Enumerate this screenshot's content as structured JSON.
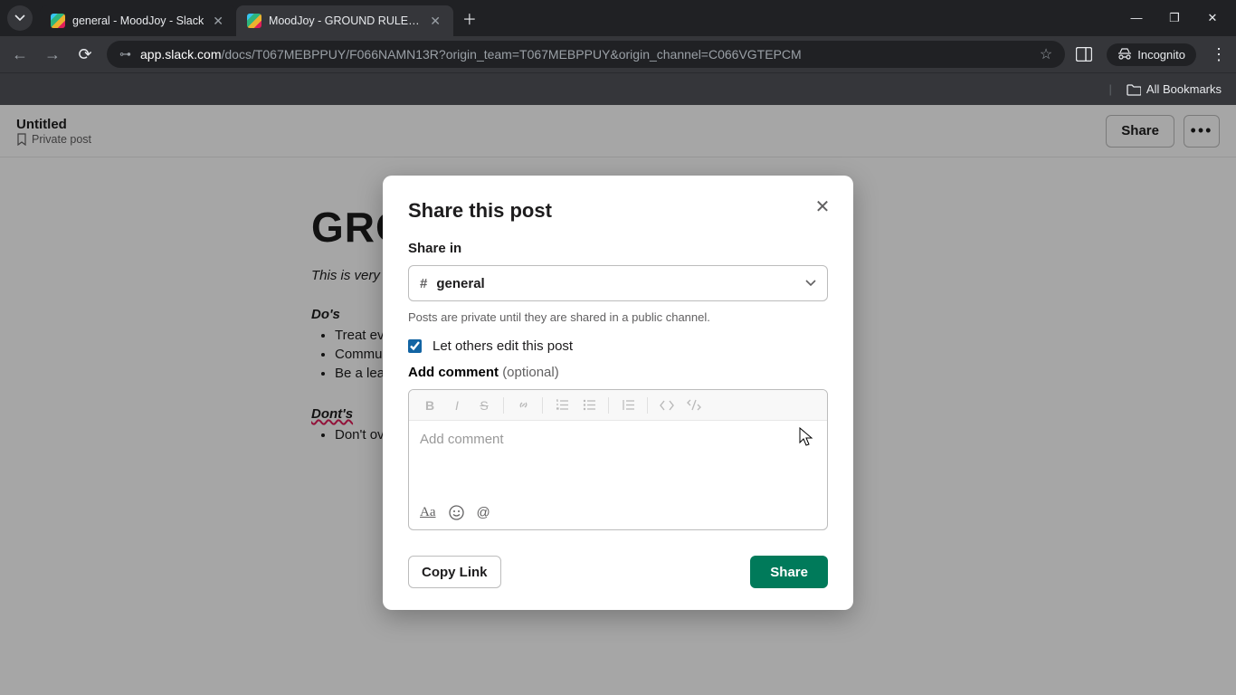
{
  "browser": {
    "tabs": [
      {
        "title": "general - MoodJoy - Slack",
        "active": false
      },
      {
        "title": "MoodJoy - GROUND RULES - S",
        "active": true
      }
    ],
    "url_host": "app.slack.com",
    "url_path": "/docs/T067MEBPPUY/F066NAMN13R?origin_team=T067MEBPPUY&origin_channel=C066VGTEPCM",
    "incognito_label": "Incognito",
    "all_bookmarks": "All Bookmarks"
  },
  "page": {
    "doc_title": "Untitled",
    "doc_privacy": "Private post",
    "share_button": "Share",
    "body": {
      "heading": "GRO",
      "intro": "This is very ir",
      "dos_label": "Do's",
      "dos_items": [
        "Treat ev",
        "Commur",
        "Be a lea"
      ],
      "donts_label": "Dont's",
      "donts_items": [
        "Don't ov"
      ]
    }
  },
  "modal": {
    "title": "Share this post",
    "share_in_label": "Share in",
    "channel_name": "general",
    "hint": "Posts are private until they are shared in a public channel.",
    "edit_checkbox_label": "Let others edit this post",
    "edit_checked": true,
    "comment_label": "Add comment",
    "comment_optional": "(optional)",
    "comment_placeholder": "Add comment",
    "copy_link": "Copy Link",
    "share": "Share"
  }
}
